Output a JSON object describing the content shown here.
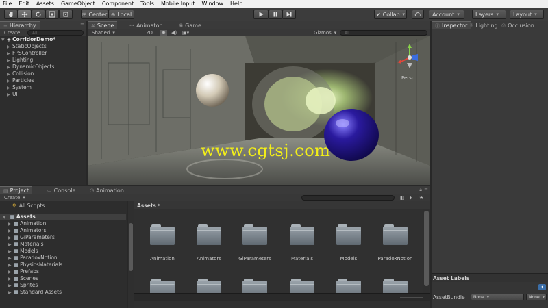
{
  "menu": [
    "File",
    "Edit",
    "Assets",
    "GameObject",
    "Component",
    "Tools",
    "Mobile Input",
    "Window",
    "Help"
  ],
  "toolbar": {
    "pivot_label": "Center",
    "space_label": "Local",
    "collab_label": "Collab",
    "account_label": "Account",
    "layers_label": "Layers",
    "layout_label": "Layout"
  },
  "hierarchy": {
    "tab": "Hierarchy",
    "create": "Create",
    "search_placeholder": "All",
    "scene_name": "CorridorDemo*",
    "items": [
      "StaticObjects",
      "FPSController",
      "Lighting",
      "DynamicObjects",
      "Collision",
      "Particles",
      "System",
      "UI"
    ]
  },
  "scene": {
    "tabs": [
      "Scene",
      "Animator",
      "Game"
    ],
    "shading": "Shaded",
    "mode_2d": "2D",
    "gizmos": "Gizmos",
    "search_placeholder": "All",
    "persp_label": "Persp",
    "watermark": "www.cgtsj.com"
  },
  "inspector": {
    "tabs": [
      "Inspector",
      "Lighting",
      "Occlusion"
    ],
    "asset_labels": "Asset Labels",
    "asset_bundle_label": "AssetBundle",
    "bundle_value": "None",
    "variant_value": "None"
  },
  "project": {
    "tabs": [
      "Project",
      "Console",
      "Animation"
    ],
    "create": "Create",
    "favorites": [
      "All Scripts"
    ],
    "root": "Assets",
    "tree": [
      "Animation",
      "Animators",
      "GiParameters",
      "Materials",
      "Models",
      "ParadoxNotion",
      "PhysicsMaterials",
      "Prefabs",
      "Scenes",
      "Sprites",
      "Standard Assets"
    ],
    "breadcrumb": "Assets",
    "grid_row1": [
      "Animation",
      "Animators",
      "GiParameters",
      "Materials",
      "Models",
      "ParadoxNotion"
    ],
    "grid_row2": [
      "",
      "",
      "",
      "",
      "",
      ""
    ]
  },
  "colors": {
    "editor_bg": "#282828",
    "panel": "#3c3c3c",
    "watermark": "#f2ee18",
    "sphere_blue": "#2a1a9e"
  }
}
